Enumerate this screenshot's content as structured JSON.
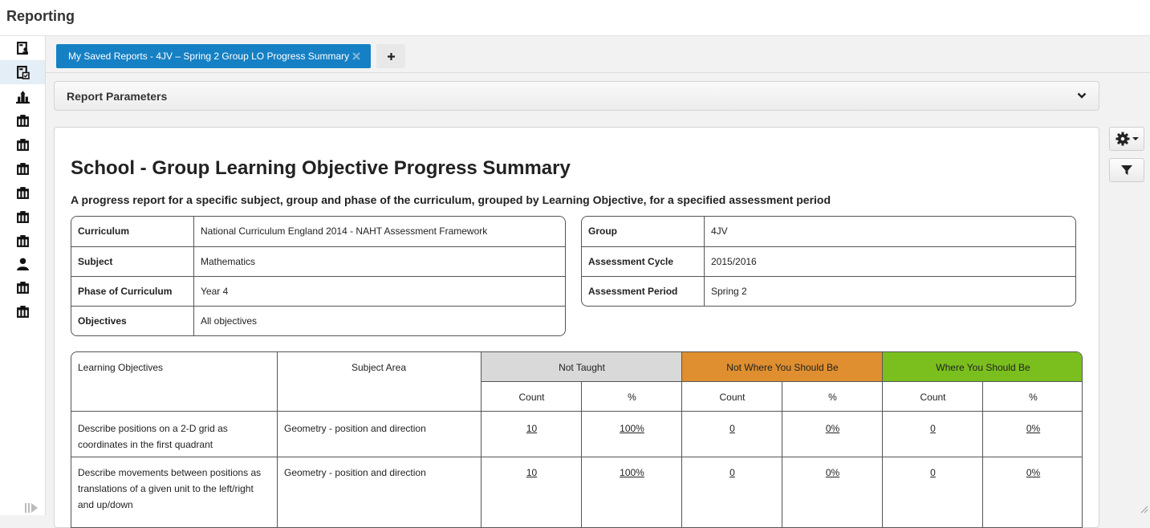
{
  "app": {
    "title": "Reporting"
  },
  "sidebar": {
    "items": [
      {
        "icon": "report-user-icon"
      },
      {
        "icon": "report-check-icon",
        "active": true
      },
      {
        "icon": "school-building-icon"
      },
      {
        "icon": "report-table-icon"
      },
      {
        "icon": "report-table-icon"
      },
      {
        "icon": "report-table-icon"
      },
      {
        "icon": "report-table-icon"
      },
      {
        "icon": "report-table-icon"
      },
      {
        "icon": "report-table-icon"
      },
      {
        "icon": "person-icon"
      },
      {
        "icon": "report-table-icon"
      },
      {
        "icon": "report-table-icon"
      }
    ]
  },
  "tabs": [
    {
      "label": "My Saved Reports - 4JV – Spring 2 Group LO Progress Summary"
    }
  ],
  "params": {
    "label": "Report Parameters"
  },
  "report": {
    "title": "School - Group Learning Objective Progress Summary",
    "description": "A progress report for a specific subject, group and phase of the curriculum, grouped by Learning Objective, for a specified assessment period",
    "left_info": [
      {
        "k": "Curriculum",
        "v": "National Curriculum England 2014 - NAHT Assessment Framework"
      },
      {
        "k": "Subject",
        "v": "Mathematics"
      },
      {
        "k": "Phase of Curriculum",
        "v": "Year 4"
      },
      {
        "k": "Objectives",
        "v": "All objectives"
      }
    ],
    "right_info": [
      {
        "k": "Group",
        "v": "4JV"
      },
      {
        "k": "Assessment Cycle",
        "v": "2015/2016"
      },
      {
        "k": "Assessment Period",
        "v": "Spring 2"
      }
    ],
    "table": {
      "col_lo": "Learning Objectives",
      "col_area": "Subject Area",
      "groups": [
        {
          "label": "Not Taught",
          "color": "#d9d9d9"
        },
        {
          "label": "Not Where You Should Be",
          "color": "#df8f2f"
        },
        {
          "label": "Where You Should Be",
          "color": "#7bbf1e"
        }
      ],
      "sub_count": "Count",
      "sub_pct": "%",
      "rows": [
        {
          "lo": "Describe positions on a 2-D grid as coordinates in the first quadrant",
          "area": "Geometry - position and direction",
          "values": [
            "10",
            "100%",
            "0",
            "0%",
            "0",
            "0%"
          ]
        },
        {
          "lo": "Describe movements between positions as translations of a given unit to the left/right and up/down",
          "area": "Geometry - position and direction",
          "values": [
            "10",
            "100%",
            "0",
            "0%",
            "0",
            "0%"
          ]
        }
      ]
    }
  },
  "colors": {
    "accent": "#1680c4",
    "not_taught": "#d9d9d9",
    "not_where": "#df8f2f",
    "where": "#7bbf1e"
  }
}
